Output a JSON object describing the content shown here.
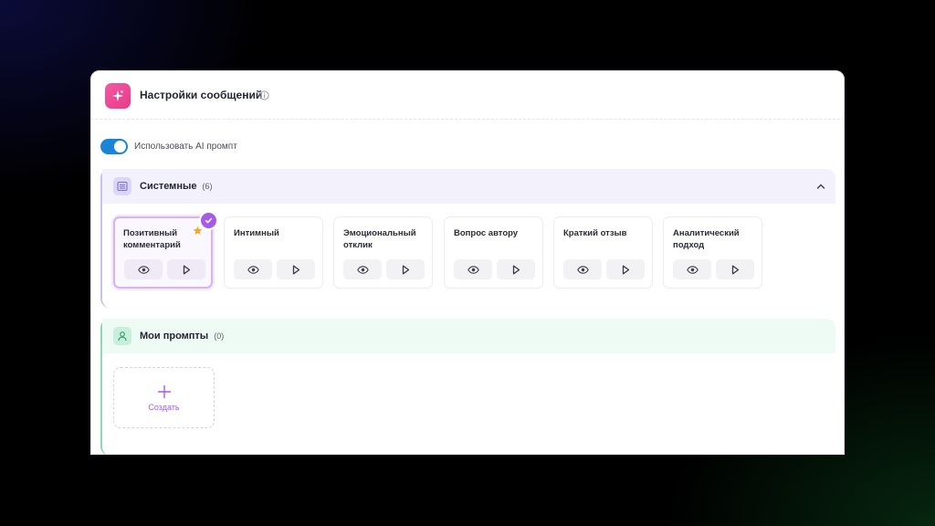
{
  "header": {
    "title": "Настройки сообщений",
    "icon": "sparkles-icon",
    "info_icon": "info-icon"
  },
  "toggle": {
    "label": "Использовать AI промпт",
    "on": true
  },
  "system": {
    "title": "Системные",
    "count": "(6)",
    "expanded": true,
    "cards": [
      {
        "title": "Позитивный комментарий",
        "selected": true,
        "favorite": true
      },
      {
        "title": "Интимный",
        "selected": false,
        "favorite": false
      },
      {
        "title": "Эмоциональный отклик",
        "selected": false,
        "favorite": false
      },
      {
        "title": "Вопрос автору",
        "selected": false,
        "favorite": false
      },
      {
        "title": "Краткий отзыв",
        "selected": false,
        "favorite": false
      },
      {
        "title": "Аналитический подход",
        "selected": false,
        "favorite": false
      }
    ]
  },
  "mine": {
    "title": "Мои промпты",
    "count": "(0)",
    "create_label": "Создать"
  },
  "colors": {
    "accent_purple": "#a65be8",
    "toggle_blue": "#1a85d6",
    "header_pink": "#e93a86",
    "star_orange": "#f5a623"
  }
}
